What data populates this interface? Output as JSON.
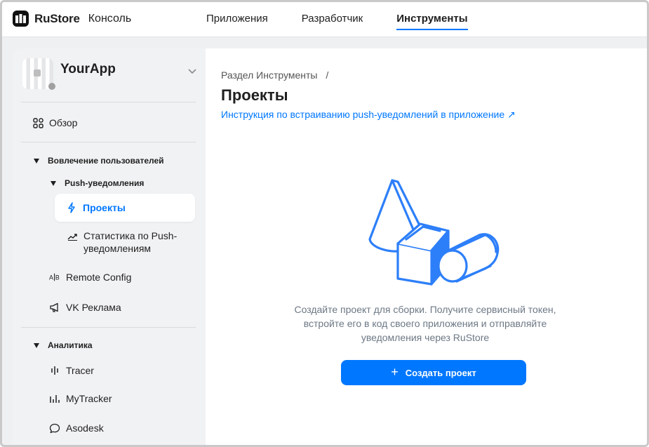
{
  "header": {
    "logo_text": "RuStore",
    "logo_sub": "Консоль",
    "nav": [
      {
        "label": "Приложения"
      },
      {
        "label": "Разработчик"
      },
      {
        "label": "Инструменты",
        "active": true
      }
    ]
  },
  "sidebar": {
    "app_name": "YourApp",
    "overview": "Обзор",
    "group_engagement": "Вовлечение пользователей",
    "subgroup_push": "Push-уведомления",
    "item_projects": "Проекты",
    "item_push_stats_1": "Статистика по Push-",
    "item_push_stats_2": "уведомлениям",
    "item_remote_config": "Remote Config",
    "item_vk_ads": "VK Реклама",
    "group_analytics": "Аналитика",
    "item_tracer": "Tracer",
    "item_mytracker": "MyTracker",
    "item_asodesk": "Asodesk"
  },
  "main": {
    "breadcrumb": "Раздел Инструменты",
    "breadcrumb_sep": "/",
    "title": "Проекты",
    "guide_link": "Инструкция по встраиванию push-уведомлений в приложение ↗",
    "empty_line1": "Создайте проект для сборки. Получите сервисный токен,",
    "empty_line2": "встройте его в код своего приложения и отправляйте",
    "empty_line3": "уведомления через RuStore",
    "create_button": "Создать проект"
  },
  "colors": {
    "accent": "#0077ff",
    "text_secondary": "#6d7885"
  }
}
